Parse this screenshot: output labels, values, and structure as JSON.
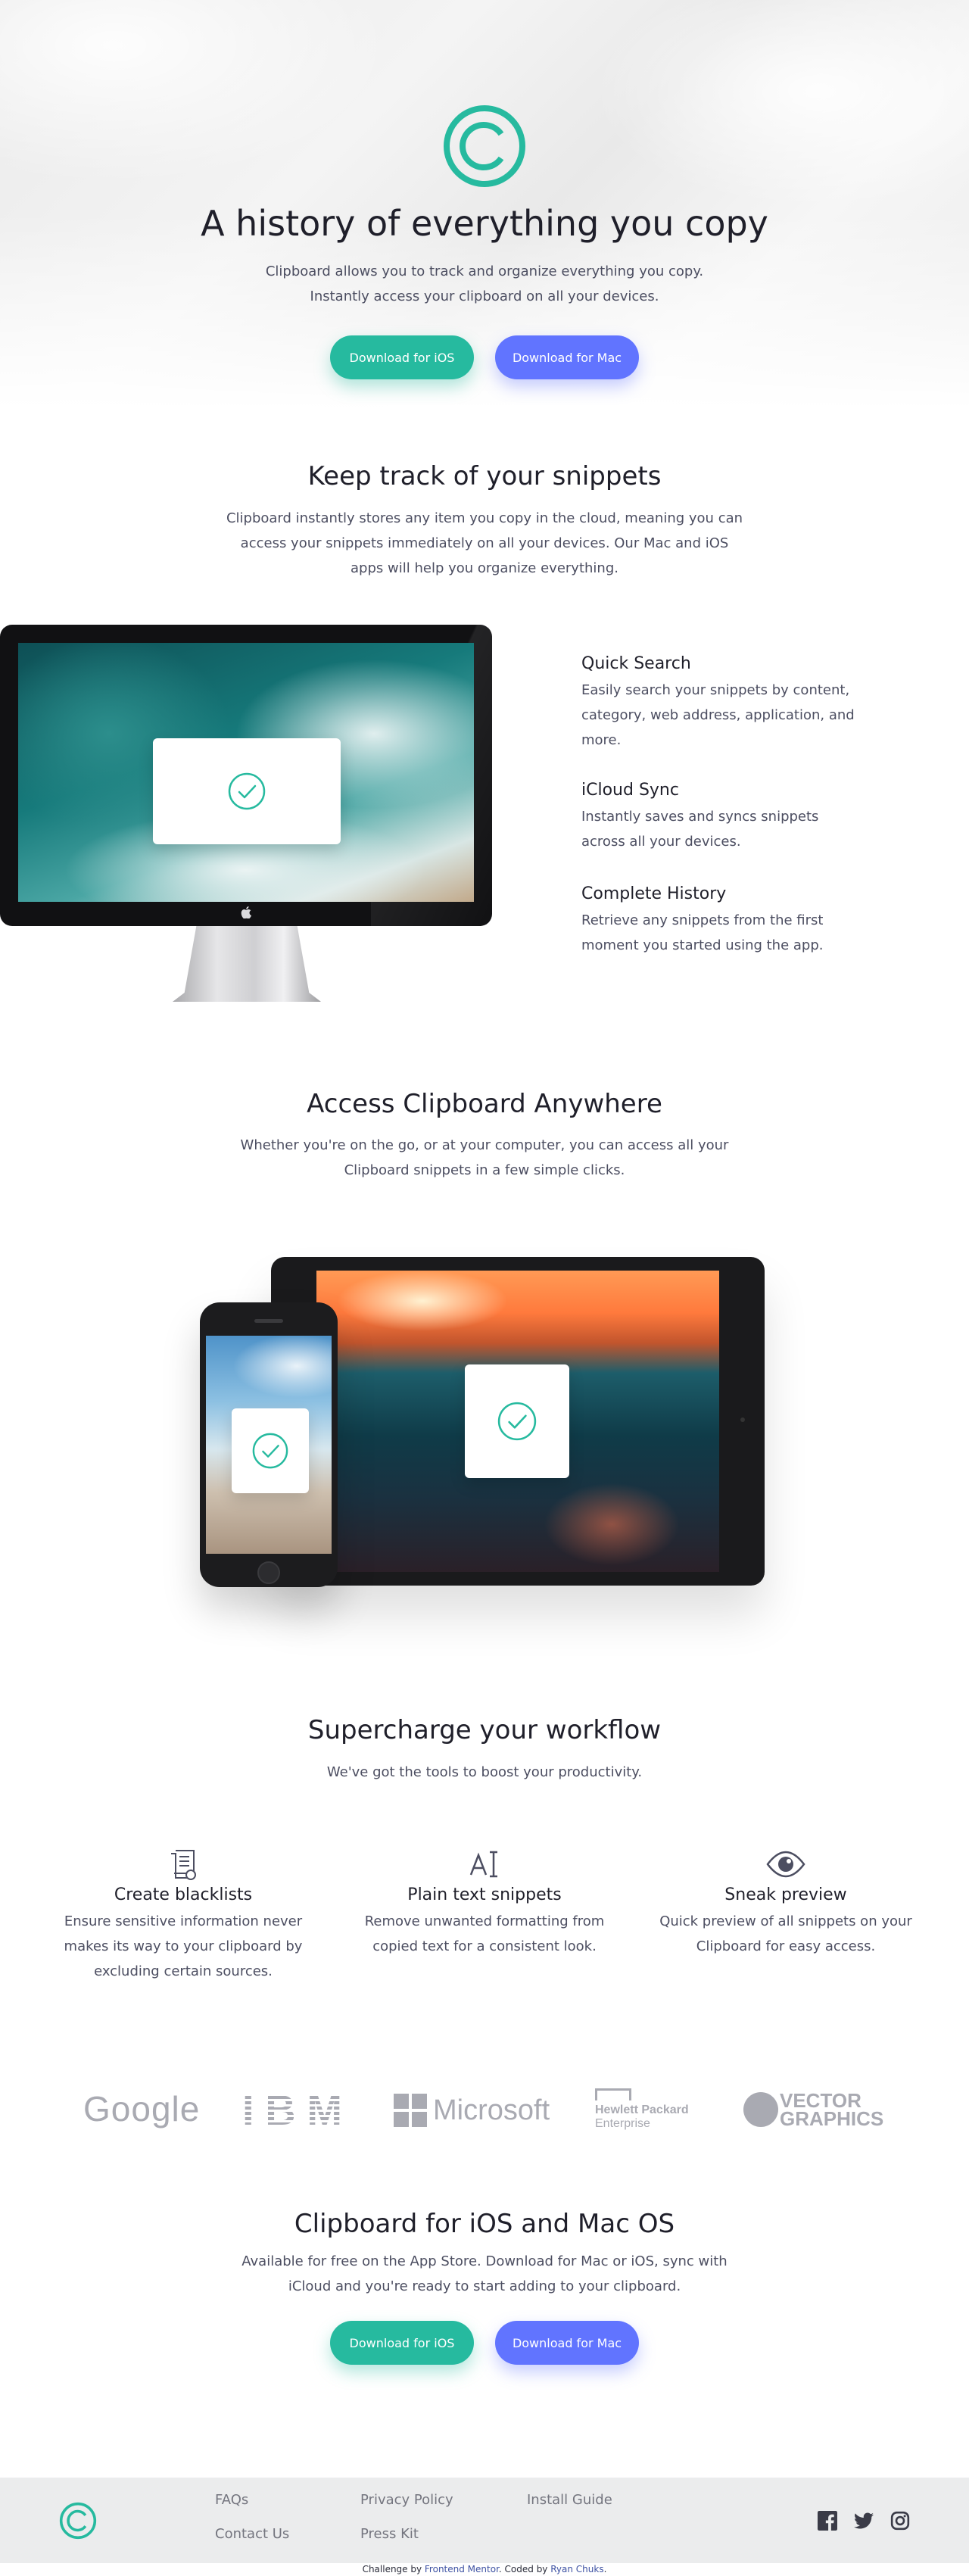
{
  "hero": {
    "title": "A history of everything you copy",
    "text_line1": "Clipboard allows you to track and organize everything you copy.",
    "text_line2": "Instantly access your clipboard on all your devices.",
    "btn_ios": "Download for iOS",
    "btn_mac": "Download for Mac"
  },
  "snippets": {
    "title": "Keep track of your snippets",
    "text_line1": "Clipboard instantly stores any item you copy in the cloud, meaning you can",
    "text_line2": "access your snippets immediately on all your devices. Our Mac and iOS",
    "text_line3": "apps will help you organize everything.",
    "features": [
      {
        "title": "Quick Search",
        "lines": [
          "Easily search your snippets by content,",
          "category, web address, application, and",
          "more."
        ]
      },
      {
        "title": "iCloud Sync",
        "lines": [
          "Instantly saves and syncs snippets",
          "across all your devices."
        ]
      },
      {
        "title": "Complete History",
        "lines": [
          "Retrieve any snippets from the first",
          "moment you started using the app."
        ]
      }
    ]
  },
  "access": {
    "title": "Access Clipboard Anywhere",
    "text_line1": "Whether you're on the go, or at your computer, you can access all your",
    "text_line2": "Clipboard snippets in a few simple clicks."
  },
  "workflow": {
    "title": "Supercharge your workflow",
    "text": "We've got the tools to boost your productivity.",
    "items": [
      {
        "icon": "blacklist-icon",
        "title": "Create blacklists",
        "lines": [
          "Ensure sensitive information never",
          "makes its way to your clipboard by",
          "excluding certain sources."
        ]
      },
      {
        "icon": "text-format-icon",
        "title": "Plain text snippets",
        "lines": [
          "Remove unwanted formatting from",
          "copied text for a consistent look."
        ]
      },
      {
        "icon": "eye-icon",
        "title": "Sneak preview",
        "lines": [
          "Quick preview of all snippets on your",
          "Clipboard for easy access."
        ]
      }
    ]
  },
  "logos": {
    "google": "Google",
    "ibm": "IBM",
    "microsoft": "Microsoft",
    "hp_line1": "Hewlett Packard",
    "hp_line2": "Enterprise",
    "vector_line1": "VECTOR",
    "vector_line2": "GRAPHICS"
  },
  "cta": {
    "title": "Clipboard for iOS and Mac OS",
    "text_line1": "Available for free on the App Store. Download for Mac or iOS, sync with",
    "text_line2": "iCloud and you're ready to start adding to your clipboard.",
    "btn_ios": "Download for iOS",
    "btn_mac": "Download for Mac"
  },
  "footer": {
    "links": [
      "FAQs",
      "Contact Us",
      "Privacy Policy",
      "Press Kit",
      "Install Guide"
    ],
    "social": [
      "facebook-icon",
      "twitter-icon",
      "instagram-icon"
    ]
  },
  "attribution": {
    "prefix": "Challenge by ",
    "link1": "Frontend Mentor",
    "middle": ". Coded by ",
    "link2": "Ryan Chuks",
    "suffix": "."
  },
  "colors": {
    "accent_green": "#26ba9f",
    "accent_blue": "#6174ff",
    "heading": "#1f1f2a",
    "body_text": "#4c4e61",
    "footer_bg": "#ebeced"
  }
}
